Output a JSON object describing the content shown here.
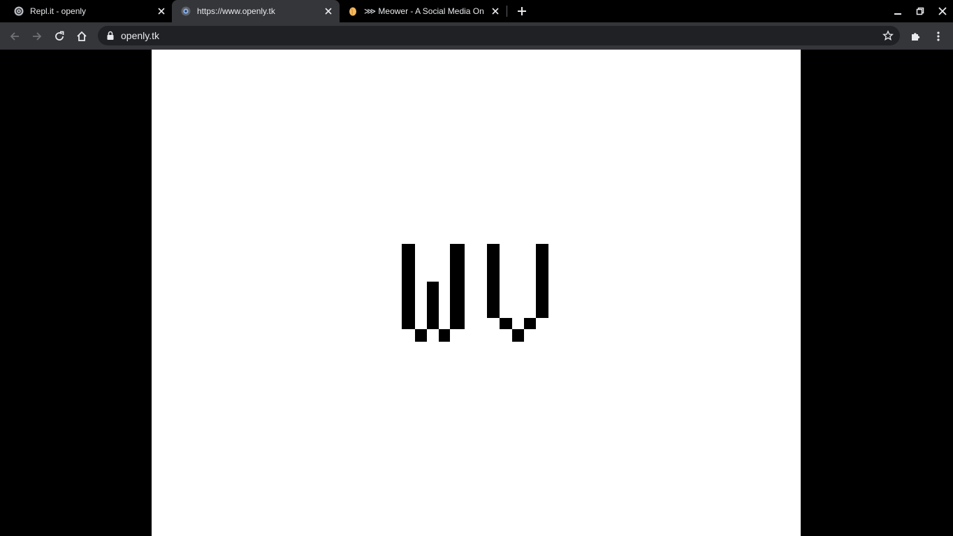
{
  "tabs": [
    {
      "title": "Repl.it - openly",
      "favicon": "replit-icon",
      "active": false
    },
    {
      "title": "https://www.openly.tk",
      "favicon": "openly-globe-icon",
      "active": true
    },
    {
      "title": "⋙ Meower - A Social Media On S",
      "favicon": "meower-icon",
      "active": false
    }
  ],
  "toolbar": {
    "url": "openly.tk"
  },
  "page": {
    "logo": "wv-pixel-logo-icon"
  },
  "colors": {
    "tabstrip": "#000000",
    "toolbar": "#35363a",
    "omnibox": "#202124",
    "text": "#e8eaed",
    "page_background": "#ffffff",
    "logo": "#000000"
  }
}
